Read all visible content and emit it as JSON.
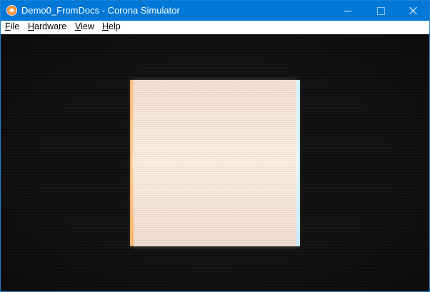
{
  "window": {
    "title": "Demo0_FromDocs - Corona Simulator",
    "app_icon": "corona-logo-icon",
    "controls": {
      "minimize_icon": "minimize-icon",
      "maximize_icon": "maximize-icon",
      "close_icon": "close-icon"
    },
    "accent_color": "#0078d7"
  },
  "menubar": {
    "items": [
      {
        "label_acc": "F",
        "label_rest": "ile"
      },
      {
        "label_acc": "H",
        "label_rest": "ardware"
      },
      {
        "label_acc": "V",
        "label_rest": "iew"
      },
      {
        "label_acc": "H",
        "label_rest": "elp"
      }
    ]
  },
  "viewport": {
    "background": "#0e0e0e",
    "content_color": "#f7eadc"
  }
}
